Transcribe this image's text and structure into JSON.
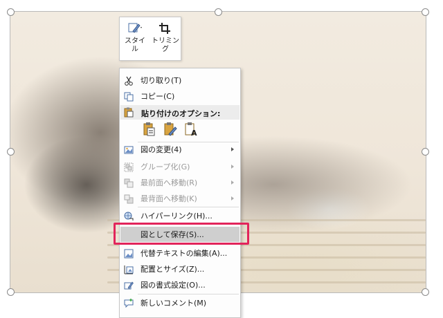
{
  "colors": {
    "highlight_outline": "#e2245b",
    "menu_hover": "#cfcfcf",
    "menu_header": "#ececec",
    "disabled_text": "#9a9a9a"
  },
  "mini_toolbar": {
    "style_label": "スタイル",
    "style_icon": "style-pen-icon",
    "crop_label": "トリミング",
    "crop_icon": "crop-icon"
  },
  "context_menu": {
    "items": [
      {
        "label": "切り取り(T)",
        "icon": "scissors-icon",
        "enabled": true,
        "submenu": false
      },
      {
        "label": "コピー(C)",
        "icon": "copy-icon",
        "enabled": true,
        "submenu": false
      },
      {
        "label": "貼り付けのオプション:",
        "icon": "paste-icon",
        "enabled": true,
        "submenu": false,
        "header": true
      },
      {
        "label": "図の変更(4)",
        "icon": "change-picture-icon",
        "enabled": true,
        "submenu": true
      },
      {
        "label": "グループ化(G)",
        "icon": "group-icon",
        "enabled": false,
        "submenu": true
      },
      {
        "label": "最前面へ移動(R)",
        "icon": "bring-front-icon",
        "enabled": false,
        "submenu": true
      },
      {
        "label": "最背面へ移動(K)",
        "icon": "send-back-icon",
        "enabled": false,
        "submenu": true
      },
      {
        "label": "ハイパーリンク(H)...",
        "icon": "hyperlink-icon",
        "enabled": true,
        "submenu": false
      },
      {
        "label": "図として保存(S)...",
        "icon": "",
        "enabled": true,
        "submenu": false,
        "highlighted": true
      },
      {
        "label": "代替テキストの編集(A)...",
        "icon": "alt-text-icon",
        "enabled": true,
        "submenu": false
      },
      {
        "label": "配置とサイズ(Z)...",
        "icon": "size-position-icon",
        "enabled": true,
        "submenu": false
      },
      {
        "label": "図の書式設定(O)...",
        "icon": "format-picture-icon",
        "enabled": true,
        "submenu": false
      },
      {
        "label": "新しいコメント(M)",
        "icon": "new-comment-icon",
        "enabled": true,
        "submenu": false
      }
    ],
    "paste_options": [
      "paste-keep-format-icon",
      "paste-picture-icon",
      "paste-text-only-icon"
    ]
  }
}
